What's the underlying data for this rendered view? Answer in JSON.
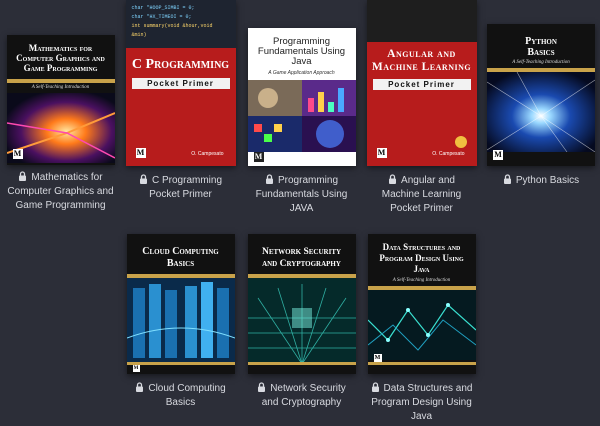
{
  "books": [
    {
      "caption": [
        "Mathematics for",
        "Computer Graphics and",
        "Game Programming"
      ],
      "cover_title": "Mathematics for Computer Graphics and Game Programming",
      "cover_subtitle": "A Self-Teaching Introduction"
    },
    {
      "caption": [
        "C Programming",
        "Pocket Primer"
      ],
      "cover_title": "C Programming",
      "cover_subtitle": "Pocket Primer",
      "cover_code_1": "char *HOOP_SIMBI = 0;",
      "cover_code_2": "char *HX_TIMEOI = 0;",
      "cover_code_3": "int summary(void &hour,void &min)",
      "cover_author": "O. Campesato"
    },
    {
      "caption": [
        "Programming",
        "Fundamentals Using",
        "JAVA"
      ],
      "cover_title": "Programming Fundamentals Using Java",
      "cover_subtitle": "A Game Application Approach"
    },
    {
      "caption": [
        "Angular and",
        "Machine Learning",
        "Pocket Primer"
      ],
      "cover_title": "Angular and Machine Learning",
      "cover_subtitle": "Pocket Primer",
      "cover_author": "O. Campesato"
    },
    {
      "caption": [
        "Python Basics"
      ],
      "cover_title": "Python Basics",
      "cover_subtitle": "A Self-Teaching Introduction"
    },
    {
      "caption": [
        "Cloud Computing",
        "Basics"
      ],
      "cover_title": "Cloud Computing Basics"
    },
    {
      "caption": [
        "Network Security",
        "and Cryptography"
      ],
      "cover_title": "Network Security and Cryptography"
    },
    {
      "caption": [
        "Data Structures and",
        "Program Design Using",
        "Java"
      ],
      "cover_title": "Data Structures and Program Design Using Java",
      "cover_subtitle": "A Self-Teaching Introduction"
    }
  ],
  "publisher_mark": "M",
  "colors": {
    "background": "#2c2e38",
    "caption": "#d8dae0",
    "accent_gold": "#c8a24a",
    "cover_red": "#b71c1c"
  },
  "icons": {
    "lock": "lock-icon"
  }
}
